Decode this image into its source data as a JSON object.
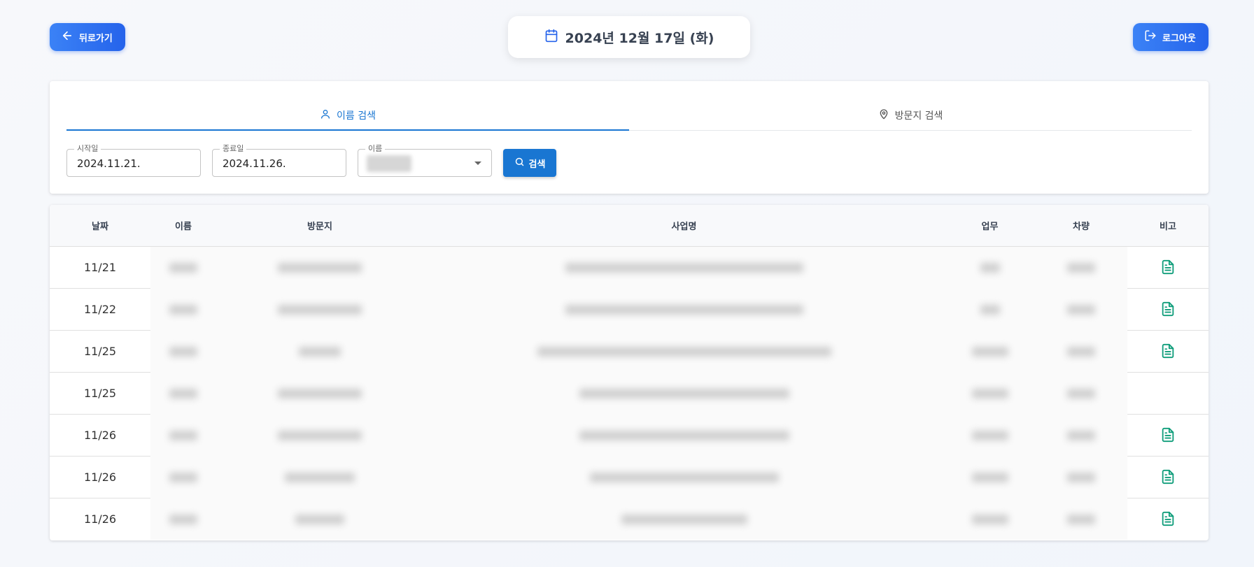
{
  "header": {
    "back_label": "뒤로가기",
    "logout_label": "로그아웃",
    "date": "2024년 12월 17일 (화)"
  },
  "search": {
    "tabs": [
      {
        "label": "이름 검색",
        "icon": "user-icon",
        "active": true
      },
      {
        "label": "방문지 검색",
        "icon": "map-pin-icon",
        "active": false
      }
    ],
    "start_label": "시작일",
    "start_value": "2024.11.21.",
    "end_label": "종료일",
    "end_value": "2024.11.26.",
    "name_label": "이름",
    "search_label": "검색"
  },
  "table": {
    "columns": [
      "날짜",
      "이름",
      "방문지",
      "사업명",
      "업무",
      "차량",
      "비고"
    ],
    "rows": [
      {
        "date": "11/21",
        "note_icon": true
      },
      {
        "date": "11/22",
        "note_icon": true
      },
      {
        "date": "11/25",
        "note_icon": true
      },
      {
        "date": "11/25",
        "note_icon": false
      },
      {
        "date": "11/26",
        "note_icon": true
      },
      {
        "date": "11/26",
        "note_icon": true
      },
      {
        "date": "11/26",
        "note_icon": true
      }
    ]
  },
  "colors": {
    "primary": "#2563eb",
    "tab_active": "#1976d2",
    "doc_icon": "#0f9d7a"
  }
}
